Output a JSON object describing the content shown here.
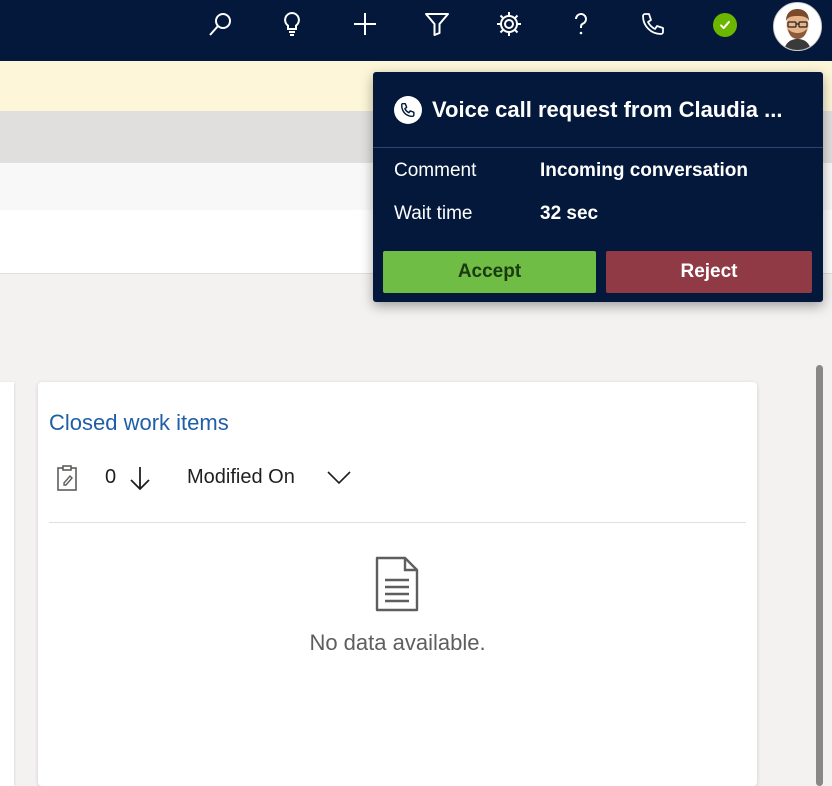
{
  "colors": {
    "topbar": "#03183b",
    "banner": "#fdf6d8",
    "link": "#1f5ea8",
    "status_available": "#6bb700",
    "accept": "#6fbd44",
    "reject": "#8f3a44"
  },
  "topbar": {
    "icons": [
      "search-icon",
      "lightbulb-icon",
      "plus-icon",
      "filter-icon",
      "settings-icon",
      "help-icon",
      "phone-icon",
      "presence-available-icon",
      "avatar"
    ]
  },
  "notification": {
    "title": "Voice call request from Claudia ...",
    "fields": [
      {
        "label": "Comment",
        "value": "Incoming conversation"
      },
      {
        "label": "Wait time",
        "value": "32 sec"
      }
    ],
    "accept_label": "Accept",
    "reject_label": "Reject"
  },
  "card": {
    "title": "Closed work items",
    "count": "0",
    "sort_field": "Modified On",
    "empty_text": "No data available."
  }
}
